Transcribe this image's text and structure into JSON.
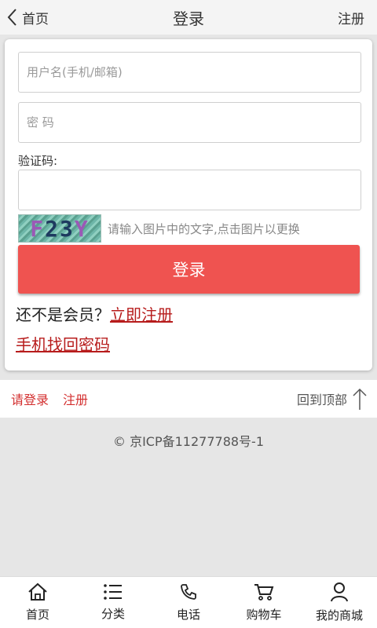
{
  "header": {
    "back_label": "首页",
    "title": "登录",
    "register_label": "注册"
  },
  "form": {
    "username_placeholder": "用户名(手机/邮箱)",
    "password_placeholder": "密 码",
    "captcha_label": "验证码:",
    "captcha_text": [
      "F",
      "2",
      "3",
      "Y"
    ],
    "captcha_hint": "请输入图片中的文字,点击图片以更换",
    "login_button": "登录",
    "not_member_text": "还不是会员？",
    "register_now_link": "立即注册",
    "phone_recover_link": "手机找回密码"
  },
  "footer": {
    "login_link": "请登录",
    "register_link": "注册",
    "back_to_top": "回到顶部",
    "icp": "© 京ICP备11277788号-1"
  },
  "tabbar": [
    {
      "icon": "home-icon",
      "label": "首页"
    },
    {
      "icon": "category-icon",
      "label": "分类"
    },
    {
      "icon": "phone-icon",
      "label": "电话"
    },
    {
      "icon": "cart-icon",
      "label": "购物车"
    },
    {
      "icon": "user-icon",
      "label": "我的商城"
    }
  ],
  "colors": {
    "accent": "#ef5350",
    "link_red": "#b71c1c"
  }
}
